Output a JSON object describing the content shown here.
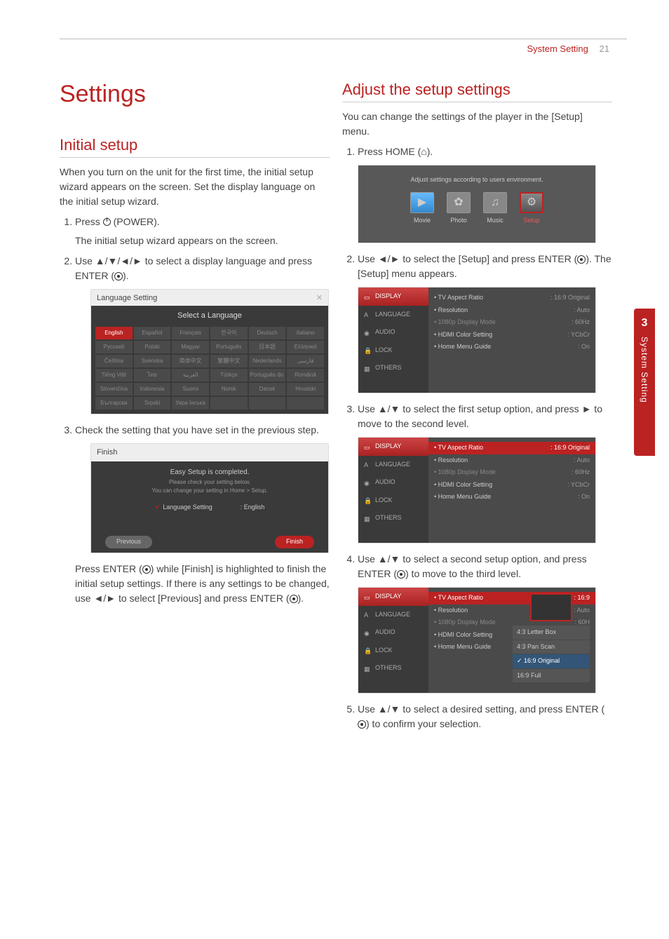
{
  "header": {
    "section": "System Setting",
    "page": "21"
  },
  "sidetab": {
    "num": "3",
    "label": "System Setting"
  },
  "left": {
    "title": "Settings",
    "initial": {
      "heading": "Initial setup",
      "intro": "When you turn on the unit for the first time, the initial setup wizard appears on the screen. Set the display language on the initial setup wizard.",
      "step1": "Press ",
      "step1b": " (POWER).",
      "step1_sub": "The initial setup wizard appears on the screen.",
      "step2a": "Use ",
      "step2_arrows": "▲/▼/◄/►",
      "step2b": " to select a display language and press ENTER (",
      "step2c": ").",
      "lang_shot": {
        "title": "Language Setting",
        "subtitle": "Select a Language",
        "langs": [
          "English",
          "Español",
          "Français",
          "한국어",
          "Deutsch",
          "Italiano",
          "Русский",
          "Polski",
          "Magyar",
          "Português",
          "日本語",
          "Ελληνικά",
          "Čeština",
          "Svenska",
          "简体中文",
          "繁體中文",
          "Nederlands",
          "فارسی",
          "Tiếng Việt",
          "ไทย",
          "العربية",
          "Türkçe",
          "Português do Brasil",
          "Română",
          "Slovenčina",
          "Indonesia",
          "Suomi",
          "Norsk",
          "Dansk",
          "Hrvatski",
          "Български",
          "Srpski",
          "Укра їнська",
          "",
          "",
          ""
        ]
      },
      "step3": "Check the setting that you have set in the previous step.",
      "finish_shot": {
        "title": "Finish",
        "msg": "Easy Setup is completed.",
        "sub1": "Please check your setting below.",
        "sub2": "You can change your setting in Home > Setup.",
        "row_label": "Language Setting",
        "row_value": ": English",
        "prev": "Previous",
        "fin": "Finish"
      },
      "after": "Press ENTER (",
      "afterb": ") while [Finish] is highlighted to finish the initial setup settings. If there is any settings to be changed, use ",
      "after_arrows": "◄/►",
      "afterc": " to select [Previous] and press ENTER (",
      "afterd": ")."
    }
  },
  "right": {
    "heading": "Adjust the setup settings",
    "intro": "You can change the settings of the player in the [Setup] menu.",
    "step1a": "Press HOME (",
    "step1b": ").",
    "home_shot": {
      "msg": "Adjust settings according to users environment.",
      "tiles": [
        {
          "icon": "▶",
          "label": "Movie"
        },
        {
          "icon": "✿",
          "label": "Photo"
        },
        {
          "icon": "♫",
          "label": "Music"
        },
        {
          "icon": "⚙",
          "label": "Setup"
        }
      ]
    },
    "step2a": "Use ",
    "step2_arrows": "◄/►",
    "step2b": " to select the [Setup] and press ENTER (",
    "step2c": "). The [Setup] menu appears.",
    "step3a": "Use ",
    "step3_arrows": "▲/▼",
    "step3b": " to select the first setup option, and press ",
    "step3_arrow2": "►",
    "step3c": " to move to the second level.",
    "step4a": "Use ",
    "step4_arrows": "▲/▼",
    "step4b": " to select a second setup option, and press ENTER (",
    "step4c": ") to move to the third level.",
    "step5a": "Use ",
    "step5_arrows": "▲/▼",
    "step5b": " to select a desired setting, and press ENTER (",
    "step5c": ") to confirm your selection.",
    "setup_tabs": [
      "DISPLAY",
      "LANGUAGE",
      "AUDIO",
      "LOCK",
      "OTHERS"
    ],
    "setup_rows": [
      {
        "label": "• TV Aspect Ratio",
        "val": ": 16:9 Original"
      },
      {
        "label": "• Resolution",
        "val": ": Auto"
      },
      {
        "label": "• 1080p Display Mode",
        "val": ": 60Hz",
        "dim": true
      },
      {
        "label": "• HDMI Color Setting",
        "val": ": YCbCr"
      },
      {
        "label": "• Home Menu Guide",
        "val": ": On"
      }
    ],
    "setup_rows_trunc": [
      {
        "label": "• TV Aspect Ratio",
        "val": ": 16:9"
      },
      {
        "label": "• Resolution",
        "val": ": Auto"
      },
      {
        "label": "• 1080p Display Mode",
        "val": ": 60H",
        "dim": true
      },
      {
        "label": "• HDMI Color Setting",
        "val": ": YCb"
      },
      {
        "label": "• Home Menu Guide",
        "val": ": On"
      }
    ],
    "aspect_opts": [
      "4:3 Letter Box",
      "4:3 Pan Scan",
      "16:9 Original",
      "16:9 Full"
    ]
  }
}
